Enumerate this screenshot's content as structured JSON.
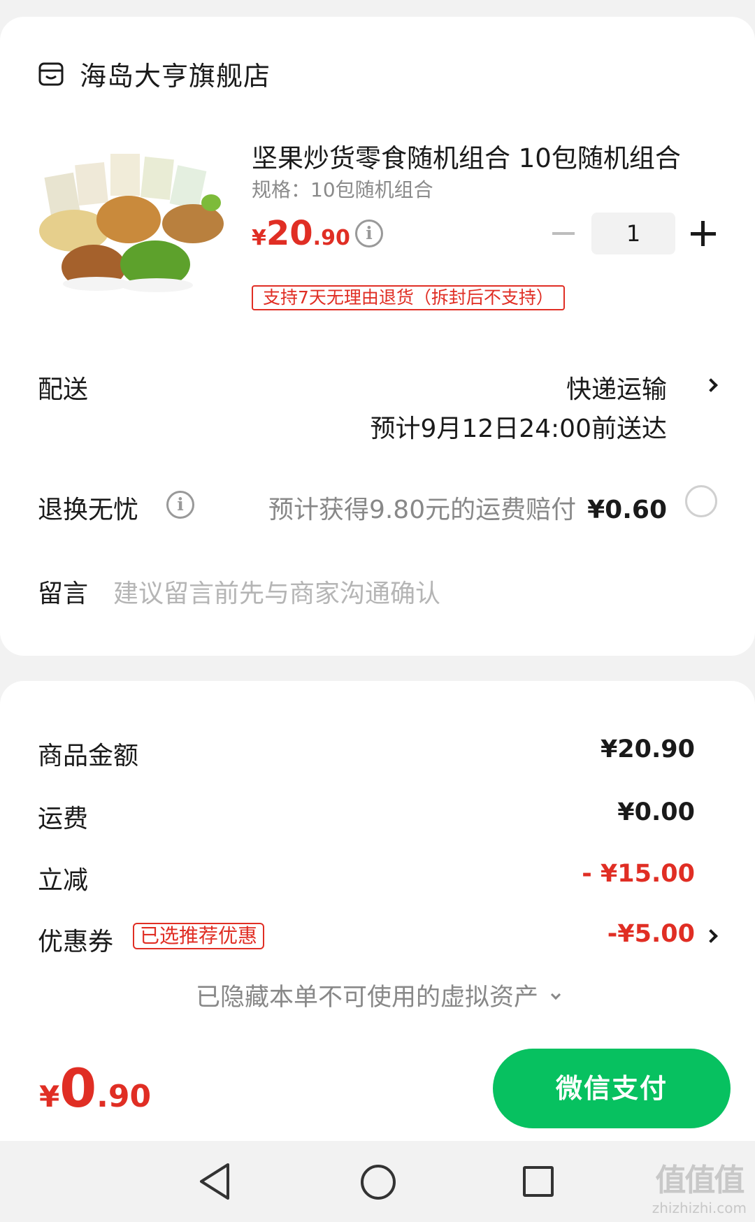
{
  "shop": {
    "name": "海岛大亨旗舰店",
    "icon": "store-icon"
  },
  "product": {
    "title": "坚果炒货零食随机组合  10包随机组合",
    "spec": "规格：10包随机组合",
    "price_currency": "¥",
    "price_int": "20",
    "price_dec": ".90",
    "quantity": "1",
    "return_policy": "支持7天无理由退货（拆封后不支持）"
  },
  "delivery": {
    "label": "配送",
    "method": "快递运输",
    "eta": "预计9月12日24:00前送达"
  },
  "refund_worry_free": {
    "label": "退换无忧",
    "description": "预计获得9.80元的运费赔付",
    "price": "¥0.60"
  },
  "message": {
    "label": "留言",
    "placeholder": "建议留言前先与商家沟通确认"
  },
  "summary": {
    "goods_label": "商品金额",
    "goods_value": "¥20.90",
    "shipping_label": "运费",
    "shipping_value": "¥0.00",
    "discount_label": "立减",
    "discount_value": "- ¥15.00",
    "coupon_label": "优惠券",
    "coupon_badge": "已选推荐优惠",
    "coupon_value": "-¥5.00",
    "hidden_assets": "已隐藏本单不可使用的虚拟资产"
  },
  "pay": {
    "total_currency": "¥",
    "total_int": "0",
    "total_dec": ".90",
    "button_label": "微信支付",
    "accent_color": "#07c160",
    "price_color": "#e02e24"
  },
  "watermark": {
    "big": "值值值",
    "small": "zhizhizhi.com"
  }
}
